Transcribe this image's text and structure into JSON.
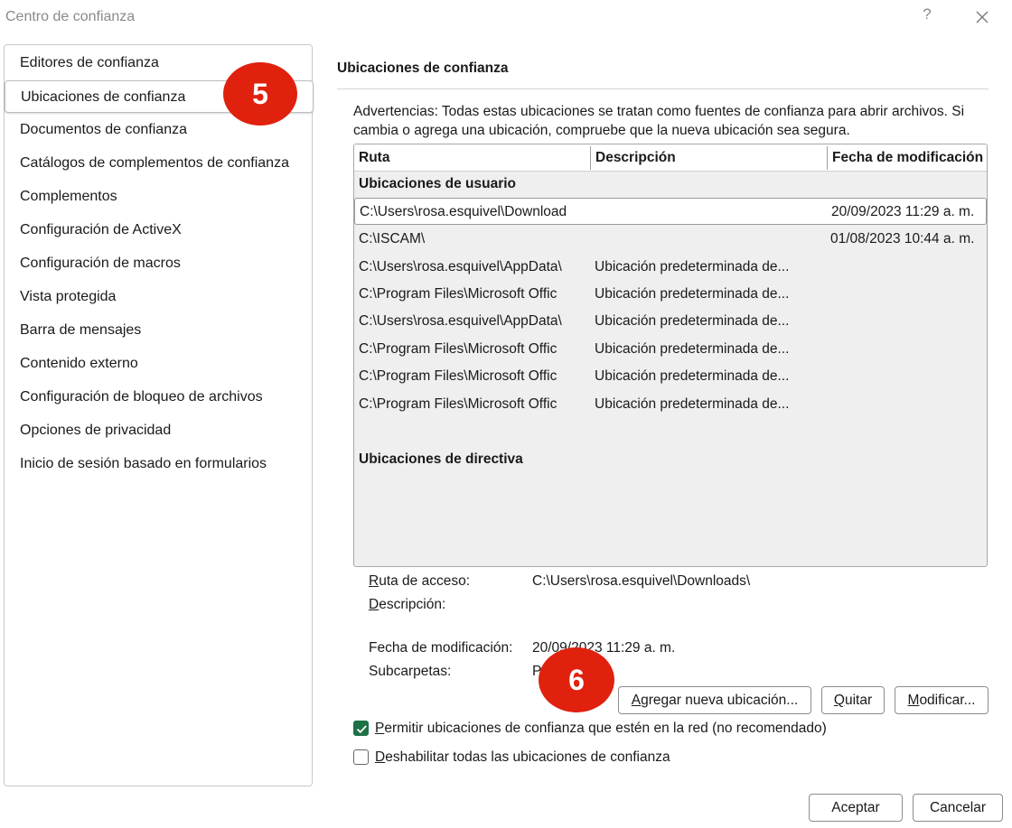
{
  "window": {
    "title": "Centro de confianza",
    "help": "?"
  },
  "sidebar": {
    "items": [
      {
        "label": "Editores de confianza"
      },
      {
        "label": "Ubicaciones de confianza"
      },
      {
        "label": "Documentos de confianza"
      },
      {
        "label": "Catálogos de complementos de confianza"
      },
      {
        "label": "Complementos"
      },
      {
        "label": "Configuración de ActiveX"
      },
      {
        "label": "Configuración de macros"
      },
      {
        "label": "Vista protegida"
      },
      {
        "label": "Barra de mensajes"
      },
      {
        "label": "Contenido externo"
      },
      {
        "label": "Configuración de bloqueo de archivos"
      },
      {
        "label": "Opciones de privacidad"
      },
      {
        "label": "Inicio de sesión basado en formularios"
      }
    ],
    "selected_index": 1
  },
  "callouts": {
    "step5": "5",
    "step6": "6"
  },
  "colors": {
    "callout": "#e0210e",
    "checkbox_checked": "#1e7145"
  },
  "main": {
    "title": "Ubicaciones de confianza",
    "warning": "Advertencias: Todas estas ubicaciones se tratan como fuentes de confianza para abrir archivos. Si cambia o agrega una ubicación, compruebe que la nueva ubicación sea segura.",
    "table": {
      "headers": [
        "Ruta",
        "Descripción",
        "Fecha de modificación"
      ],
      "user_group": "Ubicaciones de usuario",
      "rows": [
        {
          "path": "C:\\Users\\rosa.esquivel\\Download",
          "desc": "",
          "date": "20/09/2023 11:29 a. m."
        },
        {
          "path": "C:\\ISCAM\\",
          "desc": "",
          "date": "01/08/2023 10:44 a. m."
        },
        {
          "path": "C:\\Users\\rosa.esquivel\\AppData\\",
          "desc": "Ubicación predeterminada de...",
          "date": ""
        },
        {
          "path": "C:\\Program Files\\Microsoft Offic",
          "desc": "Ubicación predeterminada de...",
          "date": ""
        },
        {
          "path": "C:\\Users\\rosa.esquivel\\AppData\\",
          "desc": "Ubicación predeterminada de...",
          "date": ""
        },
        {
          "path": "C:\\Program Files\\Microsoft Offic",
          "desc": "Ubicación predeterminada de...",
          "date": ""
        },
        {
          "path": "C:\\Program Files\\Microsoft Offic",
          "desc": "Ubicación predeterminada de...",
          "date": ""
        },
        {
          "path": "C:\\Program Files\\Microsoft Offic",
          "desc": "Ubicación predeterminada de...",
          "date": ""
        }
      ],
      "policy_group": "Ubicaciones de directiva"
    },
    "details": {
      "path_label_u": "R",
      "path_label_rest": "uta de acceso:",
      "path_value": "C:\\Users\\rosa.esquivel\\Downloads\\",
      "desc_label_u": "D",
      "desc_label_rest": "escripción:",
      "date_label": "Fecha de modificación:",
      "date_value": "20/09/2023 11:29 a. m.",
      "subfolders_label": "Subcarpetas:",
      "subfolders_value": "P"
    },
    "buttons": {
      "add_u": "A",
      "add_rest": "gregar nueva ubicación...",
      "remove_u": "Q",
      "remove_rest": "uitar",
      "modify_u": "M",
      "modify_rest": "odificar..."
    },
    "options": {
      "allow_network": {
        "u": "P",
        "rest": "ermitir ubicaciones de confianza que estén en la red (no recomendado)",
        "checked": true
      },
      "disable_all": {
        "u": "D",
        "rest": "eshabilitar todas las ubicaciones de confianza",
        "checked": false
      }
    }
  },
  "footer": {
    "ok": "Aceptar",
    "cancel": "Cancelar"
  }
}
